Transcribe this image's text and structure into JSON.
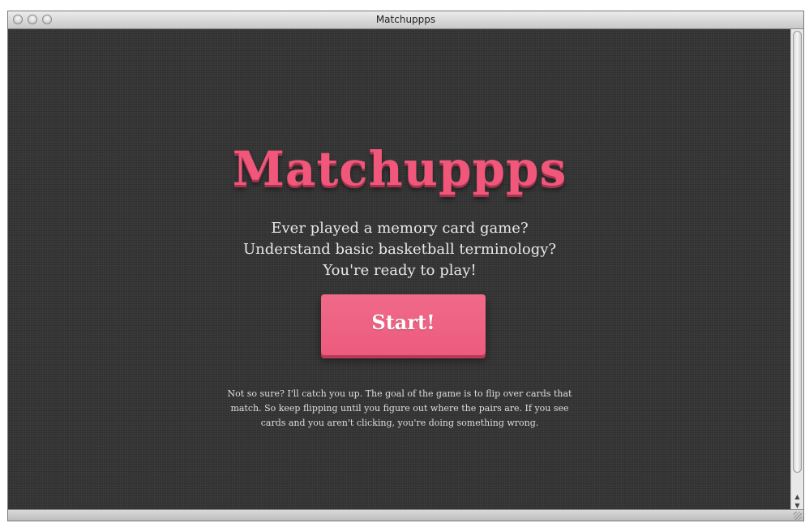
{
  "window": {
    "title": "Matchuppps"
  },
  "hero": {
    "logo": "Matchuppps",
    "intro_lines": [
      "Ever played a memory card game?",
      "Understand basic basketball terminology?",
      "You're ready to play!"
    ]
  },
  "actions": {
    "start_label": "Start!"
  },
  "help": {
    "lines": [
      "Not so sure? I'll catch you up. The goal of the game is to flip over cards that",
      "match. So keep flipping until you figure out where the pairs are. If you see",
      "cards and you aren't clicking, you're doing something wrong."
    ]
  },
  "colors": {
    "accent": "#f0577a",
    "background": "#363636",
    "text": "#e8e8e8"
  },
  "icons": {
    "close": "close-icon",
    "minimize": "minimize-icon",
    "zoom": "zoom-icon",
    "scroll_up": "arrow-up-icon",
    "scroll_down": "arrow-down-icon",
    "resize": "resize-grip-icon"
  }
}
